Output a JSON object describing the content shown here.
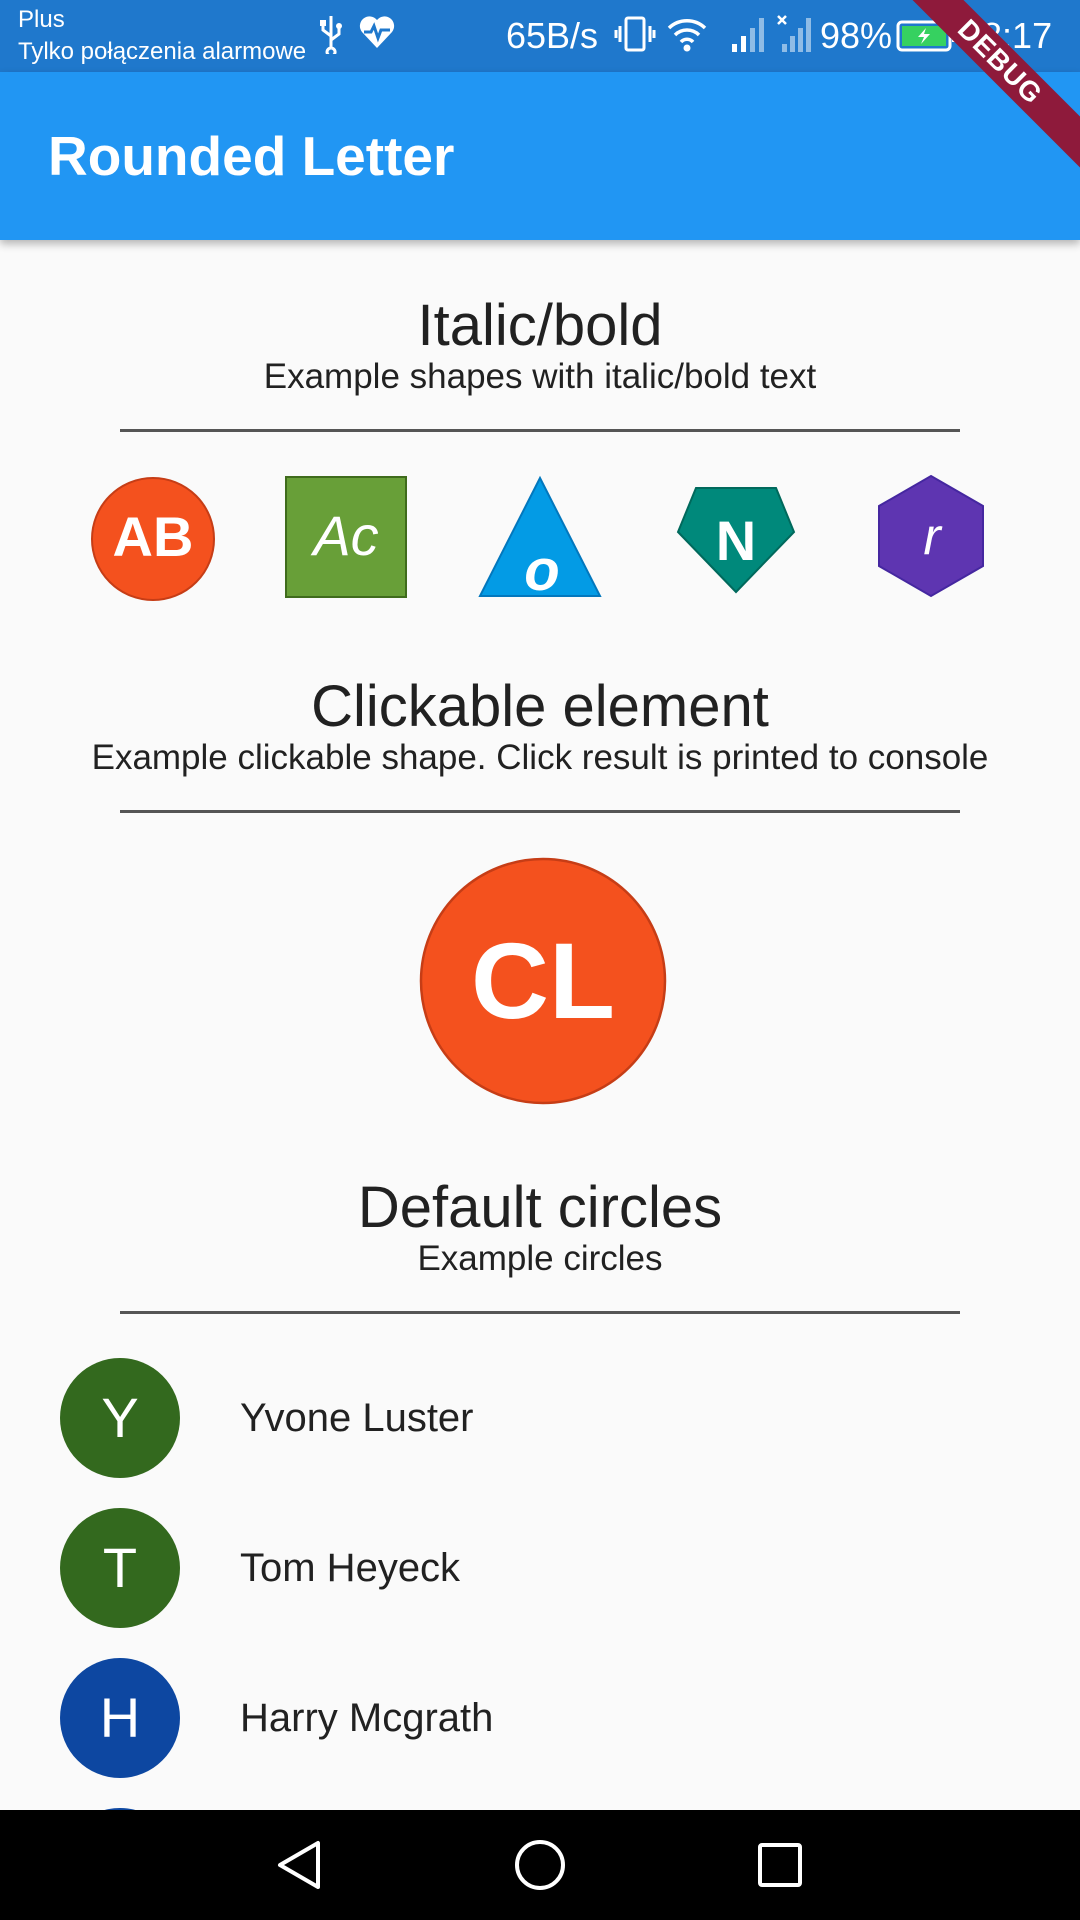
{
  "status_bar": {
    "carrier": "Plus",
    "emergency": "Tylko połączenia alarmowe",
    "net_speed": "65B/s",
    "battery": "98%",
    "time": "18:17",
    "icons": [
      "usb-icon",
      "health-icon",
      "vibrate-icon",
      "wifi-icon",
      "signal-icon",
      "signal-off-icon",
      "battery-charging-icon"
    ]
  },
  "app_bar": {
    "title": "Rounded Letter",
    "debug_label": "DEBUG",
    "color": "#2196f3"
  },
  "sections": [
    {
      "title": "Italic/bold",
      "subtitle": "Example shapes with italic/bold text",
      "shapes": [
        {
          "shape": "circle",
          "text": "AB",
          "color": "#f4511e",
          "style": "bold"
        },
        {
          "shape": "square",
          "text": "Ac",
          "color": "#689f38",
          "style": "italic"
        },
        {
          "shape": "triangle",
          "text": "o",
          "color": "#039be5",
          "style": "bold-italic"
        },
        {
          "shape": "pentagon",
          "text": "N",
          "color": "#00897b",
          "style": "bold"
        },
        {
          "shape": "hexagon",
          "text": "r",
          "color": "#5e35b1",
          "style": "italic"
        }
      ]
    },
    {
      "title": "Clickable element",
      "subtitle": "Example clickable shape. Click result is printed to console",
      "shape": {
        "shape": "circle",
        "text": "CL",
        "color": "#f4511e",
        "style": "bold"
      }
    },
    {
      "title": "Default circles",
      "subtitle": "Example circles",
      "items": [
        {
          "initial": "Y",
          "name": "Yvone Luster",
          "color": "#33691e"
        },
        {
          "initial": "T",
          "name": "Tom Heyeck",
          "color": "#33691e"
        },
        {
          "initial": "H",
          "name": "Harry Mcgrath",
          "color": "#0d47a1"
        },
        {
          "initial": "",
          "name": "",
          "color": "#0d47a1"
        }
      ]
    }
  ],
  "nav_bar": {
    "buttons": [
      "back-icon",
      "home-icon",
      "recents-icon"
    ]
  }
}
